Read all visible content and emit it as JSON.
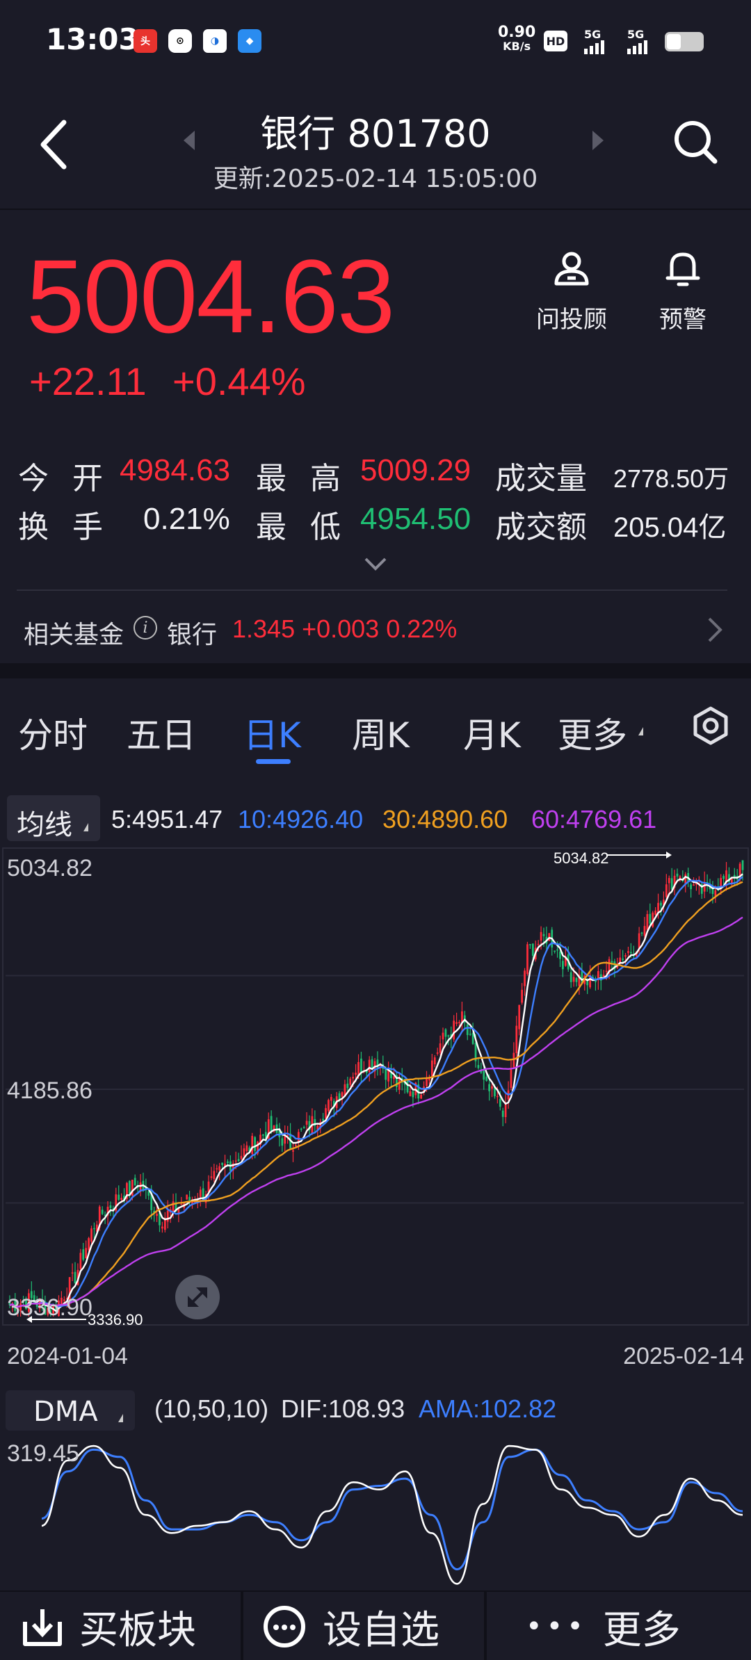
{
  "status_bar": {
    "time": "13:03",
    "net_speed_value": "0.90",
    "net_speed_unit": "KB/s",
    "hd_label": "HD",
    "signal_1": "5G",
    "signal_2": "5G",
    "app_icons": [
      "toutiao-icon",
      "app-icon-2",
      "app-icon-3",
      "app-icon-4"
    ]
  },
  "header": {
    "title": "银行 801780",
    "update_time": "更新:2025-02-14 15:05:00"
  },
  "price": {
    "last": "5004.63",
    "change": "+22.11",
    "change_pct": "+0.44%"
  },
  "tools": {
    "advisor_label": "问投顾",
    "alert_label": "预警"
  },
  "stats": {
    "open_label_1": "今",
    "open_label_2": "开",
    "open_value": "4984.63",
    "high_label_1": "最",
    "high_label_2": "高",
    "high_value": "5009.29",
    "volume_label": "成交量",
    "volume_value": "2778.50万",
    "turnover_label_1": "换",
    "turnover_label_2": "手",
    "turnover_value": "0.21%",
    "low_label_1": "最",
    "low_label_2": "低",
    "low_value": "4954.50",
    "amount_label": "成交额",
    "amount_value": "205.04亿"
  },
  "fund": {
    "label": "相关基金",
    "name": "银行",
    "values": "1.345 +0.003 0.22%"
  },
  "tabs": [
    {
      "label": "分时"
    },
    {
      "label": "五日"
    },
    {
      "label": "日K"
    },
    {
      "label": "周K"
    },
    {
      "label": "月K"
    },
    {
      "label": "更多"
    }
  ],
  "ma_legend": {
    "select_label": "均线",
    "ma5": "5:4951.47",
    "ma10": "10:4926.40",
    "ma30": "30:4890.60",
    "ma60": "60:4769.61"
  },
  "kline": {
    "y_top_label": "5034.82",
    "y_mid_label": "4185.86",
    "y_bottom_label": "3336.90",
    "max_marker": "5034.82",
    "min_marker": "3336.90",
    "date_start": "2024-01-04",
    "date_end": "2025-02-14"
  },
  "dma": {
    "select_label": "DMA",
    "params": "(10,50,10)",
    "dif": "DIF:108.93",
    "ama": "AMA:102.82",
    "y_max_label": "319.45"
  },
  "bottom_bar": {
    "buy_label": "买板块",
    "watch_label": "设自选",
    "more_label": "更多"
  },
  "colors": {
    "up": "#ff2d3b",
    "down": "#1fbf73",
    "accent": "#3d7fff",
    "ma5": "#ffffff",
    "ma10": "#3d7fff",
    "ma30": "#f0a020",
    "ma60": "#c040f0"
  },
  "chart_data": [
    {
      "type": "candlestick",
      "title": "",
      "x_range": [
        "2024-01-04",
        "2025-02-14"
      ],
      "ylim": [
        3336.9,
        5034.82
      ],
      "y_ticks": [
        5034.82,
        4185.86,
        3336.9
      ],
      "series": [
        {
          "name": "5",
          "last": 4951.47
        },
        {
          "name": "10",
          "last": 4926.4
        },
        {
          "name": "30",
          "last": 4890.6
        },
        {
          "name": "60",
          "last": 4769.61
        }
      ],
      "close_path": [
        3380,
        3400,
        3360,
        3480,
        3700,
        3780,
        3840,
        3700,
        3760,
        3800,
        3900,
        3960,
        4040,
        3980,
        4060,
        4140,
        4260,
        4300,
        4200,
        4180,
        4360,
        4450,
        4200,
        4100,
        4700,
        4760,
        4620,
        4580,
        4660,
        4720,
        4880,
        5000,
        4920,
        4960,
        5004.63
      ]
    },
    {
      "type": "line",
      "title": "",
      "ylim": [
        -110,
        319.45
      ],
      "series": [
        {
          "name": "DIF",
          "last": 108.93,
          "values": [
            80,
            260,
            300,
            240,
            110,
            60,
            80,
            90,
            120,
            70,
            20,
            120,
            200,
            180,
            230,
            60,
            -80,
            140,
            300,
            290,
            180,
            130,
            110,
            50,
            110,
            210,
            150,
            110
          ]
        },
        {
          "name": "AMA",
          "last": 102.82,
          "values": [
            100,
            230,
            290,
            270,
            150,
            70,
            70,
            90,
            110,
            90,
            40,
            90,
            180,
            190,
            210,
            110,
            -40,
            90,
            270,
            290,
            220,
            150,
            120,
            70,
            90,
            200,
            170,
            120
          ]
        }
      ]
    }
  ]
}
